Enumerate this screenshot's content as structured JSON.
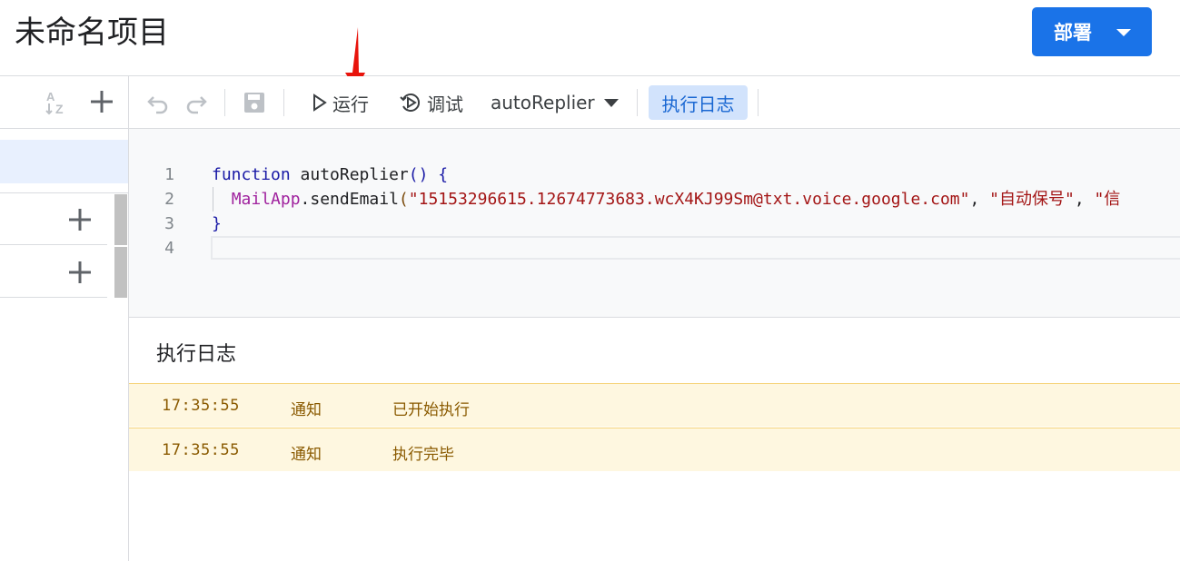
{
  "header": {
    "project_title": "未命名项目",
    "deploy_label": "部署"
  },
  "toolbar": {
    "run_label": "运行",
    "debug_label": "调试",
    "function_selected": "autoReplier",
    "execution_log_label": "执行日志"
  },
  "editor": {
    "lines": [
      {
        "number": "1",
        "tokens": [
          {
            "text": "function",
            "class": "kw"
          },
          {
            "text": " autoReplier",
            "class": "fn"
          },
          {
            "text": "()",
            "class": "paren"
          },
          {
            "text": " {",
            "class": "paren"
          }
        ]
      },
      {
        "number": "2",
        "tokens": [
          {
            "text": "  ",
            "class": "plain"
          },
          {
            "text": "MailApp",
            "class": "cls"
          },
          {
            "text": ".sendEmail",
            "class": "plain"
          },
          {
            "text": "(",
            "class": "paren2"
          },
          {
            "text": "\"15153296615.12674773683.wcX4KJ99Sm@txt.voice.google.com\"",
            "class": "str"
          },
          {
            "text": ", ",
            "class": "plain"
          },
          {
            "text": "\"自动保号\"",
            "class": "str"
          },
          {
            "text": ", ",
            "class": "plain"
          },
          {
            "text": "\"信",
            "class": "str"
          }
        ]
      },
      {
        "number": "3",
        "tokens": [
          {
            "text": "}",
            "class": "paren"
          }
        ]
      },
      {
        "number": "4",
        "tokens": []
      }
    ]
  },
  "log": {
    "title": "执行日志",
    "entries": [
      {
        "time": "17:35:55",
        "level": "通知",
        "message": "已开始执行"
      },
      {
        "time": "17:35:55",
        "level": "通知",
        "message": "执行完毕"
      }
    ]
  },
  "colors": {
    "accent": "#1a73e8",
    "log_background": "#fef7e0",
    "log_text": "#8a5a00",
    "annotation_arrow": "#e8140c"
  },
  "icons": {
    "sort": "sort-az-icon",
    "add": "plus-icon",
    "undo": "undo-icon",
    "redo": "redo-icon",
    "save": "save-icon",
    "run": "play-icon",
    "debug": "debug-icon"
  }
}
